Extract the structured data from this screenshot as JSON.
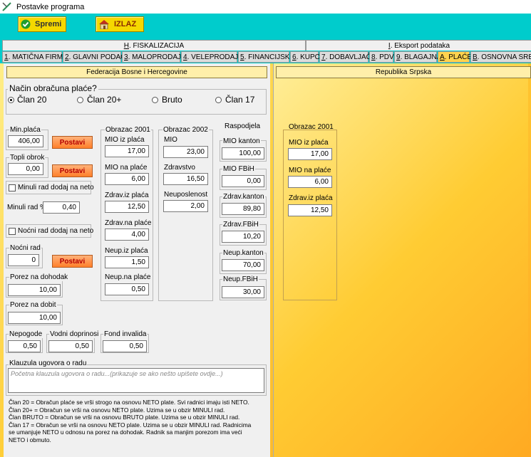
{
  "window": {
    "title": "Postavke programa"
  },
  "toolbar": {
    "save_label": "Spremi",
    "exit_label": "IZLAZ"
  },
  "tab_groups": [
    {
      "key": "H",
      "label": ". FISKALIZACIJA"
    },
    {
      "key": "I",
      "label": ". Eksport podataka"
    }
  ],
  "tabs": [
    {
      "key": "1",
      "label": ". MATIČNA FIRMA"
    },
    {
      "key": "2",
      "label": ". GLAVNI PODACI"
    },
    {
      "key": "3",
      "label": ". MALOPRODAJA"
    },
    {
      "key": "4",
      "label": ". VELEPRODAJA"
    },
    {
      "key": "5",
      "label": ". FINANCIJSKO"
    },
    {
      "key": "6",
      "label": ". KUPCI"
    },
    {
      "key": "7",
      "label": ". DOBAVLJAČI"
    },
    {
      "key": "8",
      "label": ". PDV"
    },
    {
      "key": "9",
      "label": ". BLAGAJNA"
    },
    {
      "key": "A",
      "label": ". PLAĆE"
    },
    {
      "key": "B",
      "label": ". OSNOVNA SRED"
    }
  ],
  "left": {
    "header": "Federacija Bosne i Hercegovine",
    "method": {
      "title": "Način obračuna plaće?",
      "options": [
        "Član 20",
        "Član 20+",
        "Bruto",
        "Član 17"
      ],
      "selected": "Član 20"
    },
    "min_placa": {
      "label": "Min.plaća",
      "value": "406,00"
    },
    "topli_obrok": {
      "label": "Topli obrok",
      "value": "0,00"
    },
    "postavi_label": "Postavi",
    "minuli_chk": "Minuli rad dodaj na neto",
    "minuli_pct": {
      "label": "Minuli rad %",
      "value": "0,40"
    },
    "nocni_chk": "Noćni rad dodaj na neto",
    "nocni_rad": {
      "label": "Noćni rad",
      "value": "0"
    },
    "porez_dohodak": {
      "label": "Porez na dohodak",
      "value": "10,00"
    },
    "porez_dobit": {
      "label": "Porez na dobit",
      "value": "10,00"
    },
    "nepogode": {
      "label": "Nepogode",
      "value": "0,50"
    },
    "vodni": {
      "label": "Vodni doprinosi",
      "value": "0,50"
    },
    "fond": {
      "label": "Fond invalida",
      "value": "0,50"
    },
    "ob2001": {
      "title": "Obrazac 2001",
      "fields": [
        {
          "label": "MIO iz plaća",
          "value": "17,00"
        },
        {
          "label": "MIO na plaće",
          "value": "6,00"
        },
        {
          "label": "Zdrav.iz plaća",
          "value": "12,50"
        },
        {
          "label": "Zdrav.na plaće",
          "value": "4,00"
        },
        {
          "label": "Neup.iz plaća",
          "value": "1,50"
        },
        {
          "label": "Neup.na plaće",
          "value": "0,50"
        }
      ]
    },
    "ob2002": {
      "title": "Obrazac 2002",
      "fields": [
        {
          "label": "MIO",
          "value": "23,00"
        },
        {
          "label": "Zdravstvo",
          "value": "16,50"
        },
        {
          "label": "Neuposlenost",
          "value": "2,00"
        }
      ]
    },
    "raspodjela": {
      "title": "Raspodjela",
      "fields": [
        {
          "label": "MIO kanton",
          "value": "100,00"
        },
        {
          "label": "MIO FBiH",
          "value": "0,00"
        },
        {
          "label": "Zdrav.kanton",
          "value": "89,80"
        },
        {
          "label": "Zdrav.FBiH",
          "value": "10,20"
        },
        {
          "label": "Neup.kanton",
          "value": "70,00"
        },
        {
          "label": "Neup.FBiH",
          "value": "30,00"
        }
      ]
    },
    "klauzula": {
      "label": "Klauzula ugovora o radu",
      "placeholder": "Početna klauzula ugovora o radu...(prikazuje se ako nešto upišete ovdje...)"
    },
    "notes": [
      "Član 20 = Obračun plaće se vrši strogo na osnovu NETO plate. Svi radnici imaju isti NETO.",
      "Član 20+ = Obračun se vrši na osnovu NETO plate. Uzima se u obzir MINULI rad.",
      "Član BRUTO = Obračun se vrši na osnovu BRUTO plate. Uzima se u obzir MINULI rad.",
      "Član 17 = Obračun se vrši na osnovu NETO plate. Uzima se u obzir MINULI rad. Radnicima",
      "se umanjuje NETO u odnosu na porez na dohodak. Radnik sa manjim porezom ima veći",
      "NETO i obmuto."
    ]
  },
  "right": {
    "header": "Republika Srpska",
    "ob2001": {
      "title": "Obrazac 2001",
      "fields": [
        {
          "label": "MIO iz plaća",
          "value": "17,00"
        },
        {
          "label": "MIO na plaće",
          "value": "6,00"
        },
        {
          "label": "Zdrav.iz plaća",
          "value": "12,50"
        }
      ]
    }
  },
  "colors": {
    "toolbar": "#00cccc",
    "button": "#f5d800",
    "postavi": "#ff7f2a",
    "active_tab": "#ffd34d"
  }
}
